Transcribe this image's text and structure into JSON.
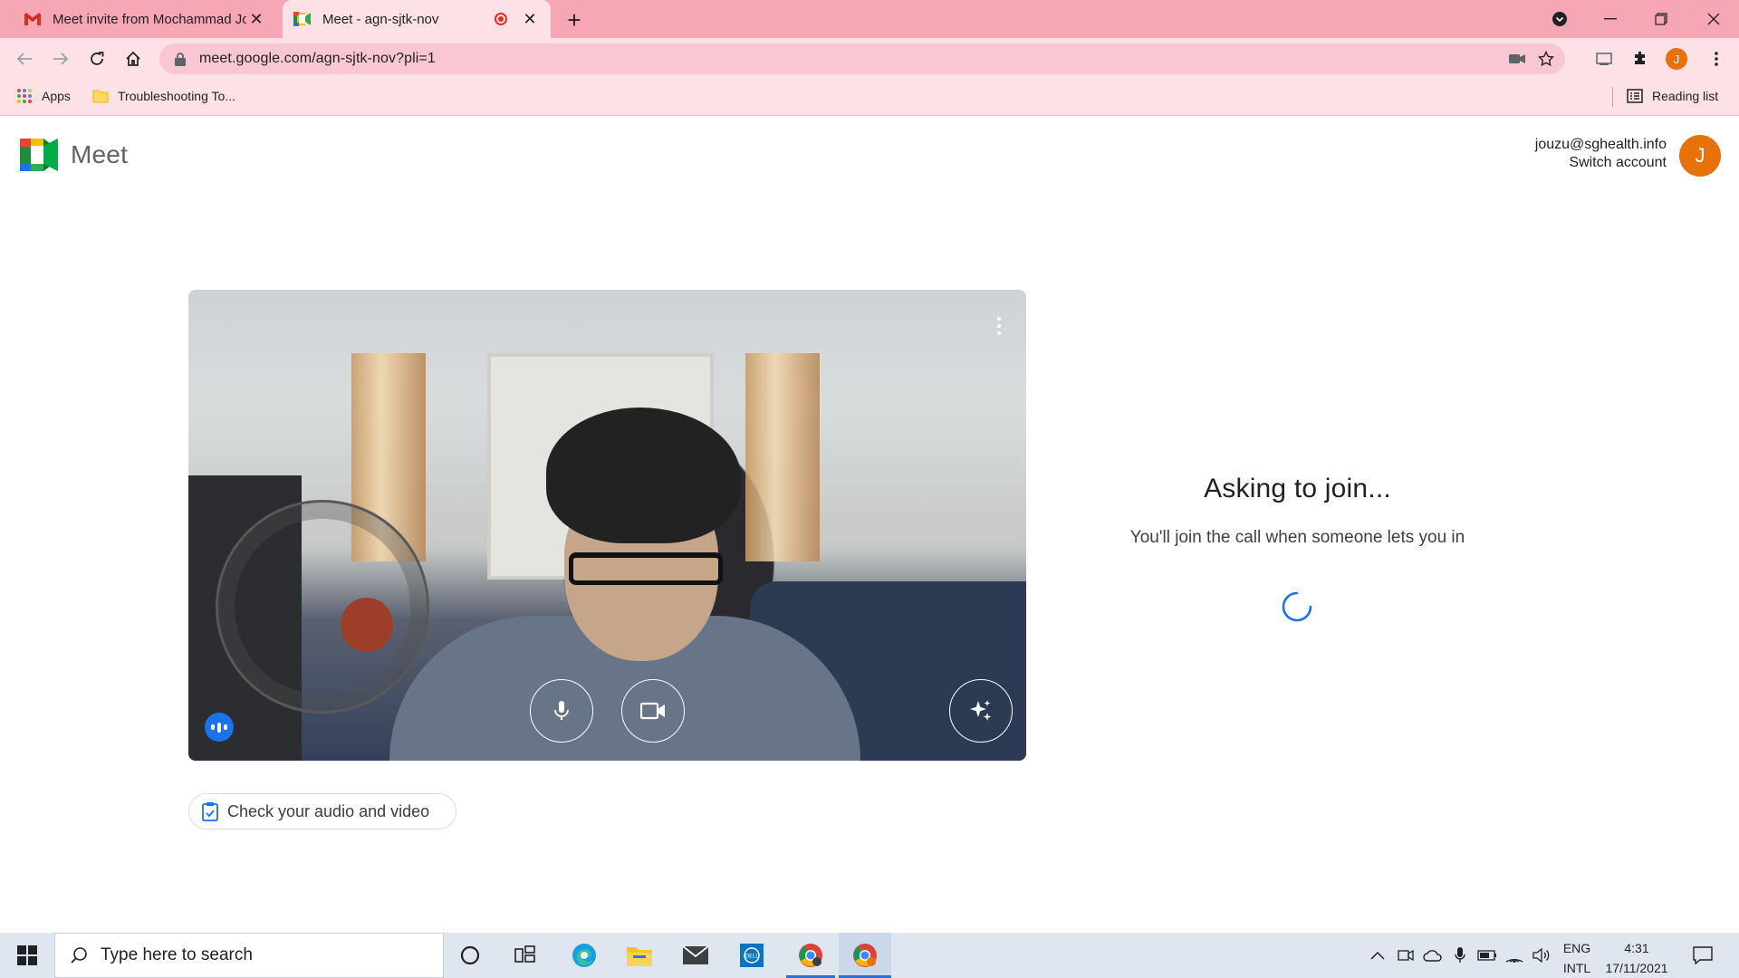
{
  "browser": {
    "tabs": [
      {
        "title": "Meet invite from Mochammad Jo",
        "favicon": "gmail-icon",
        "active": false
      },
      {
        "title": "Meet - agn-sjtk-nov",
        "favicon": "meet-icon",
        "active": true
      }
    ],
    "url": "meet.google.com/agn-sjtk-nov?pli=1",
    "profile_initial": "J",
    "bookmarks": [
      {
        "label": "Apps",
        "icon": "apps-grid-icon"
      },
      {
        "label": "Troubleshooting To...",
        "icon": "folder-icon"
      }
    ],
    "reading_list": "Reading list"
  },
  "meet": {
    "brand": "Meet",
    "account_email": "jouzu@sghealth.info",
    "switch_account": "Switch account",
    "avatar_initial": "J",
    "check_av_label": "Check your audio and video",
    "asking_title": "Asking to join...",
    "asking_subtitle": "You'll join the call when someone lets you in"
  },
  "taskbar": {
    "search_placeholder": "Type here to search",
    "language_top": "ENG",
    "language_bottom": "INTL",
    "time": "4:31",
    "date": "17/11/2021"
  },
  "colors": {
    "tab_strip": "#f7a6b6",
    "toolbar": "#fde1e6",
    "avatar": "#e8710a",
    "accent_blue": "#1a73e8"
  }
}
